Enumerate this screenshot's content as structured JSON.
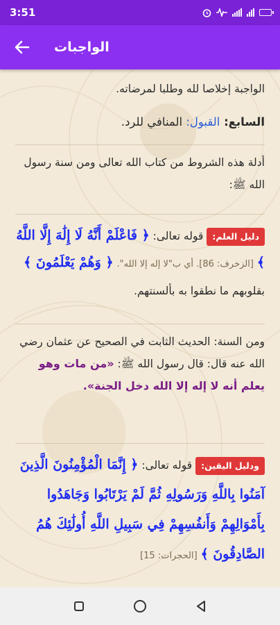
{
  "status_bar": {
    "time": "3:51"
  },
  "app_bar": {
    "title": "الواجبات",
    "back_icon": "arrow-back-icon"
  },
  "content": {
    "p0": "الواجبة إخلاصا لله وطلبا لمرضاته.",
    "p1_label": "السابع: ",
    "p1_term": "القبول: ",
    "p1_text": "المنافي للرد.",
    "p2": "أدلة هذه الشروط من كتاب الله تعالى ومن سنة رسول الله ﷺ:",
    "b1_badge": "دليل العلم:",
    "b1_intro": "قوله تعالى: ",
    "b1_verse1": "﴿ فَاعْلَمْ أَنَّهُ لَا إِلَٰهَ إِلَّا اللَّهُ ﴾",
    "b1_ref": "[الزخرف: 86]. أي ب\"لا إله إلا الله\".",
    "b1_verse2": "﴿ وَهُمْ يَعْلَمُونَ ﴾",
    "b1_tail": "بقلوبهم ما نطقوا به بألسنتهم.",
    "p3_text": "ومن السنة: الحديث الثابت في الصحيح عن عثمان رضي الله عنه قال: قال رسول الله ﷺ: ",
    "p3_hadith": "«من مات وهو يعلم أنه لا إله إلا الله دخل الجنة».",
    "b2_badge": "ودليل اليقين:",
    "b2_intro": "قوله تعالى: ",
    "b2_verse": "﴿ إِنَّمَا الْمُؤْمِنُونَ الَّذِينَ آمَنُوا بِاللَّهِ وَرَسُولِهِ ثُمَّ لَمْ يَرْتَابُوا وَجَاهَدُوا بِأَمْوَالِهِمْ وَأَنفُسِهِمْ فِي سَبِيلِ اللَّهِ أُولَٰئِكَ هُمُ الصَّادِقُونَ ﴾",
    "b2_ref": "[الحجرات: 15]"
  },
  "colors": {
    "status_bar": "#7a22d6",
    "app_bar": "#8b2ff0",
    "background": "#f3ead9",
    "badge": "#e03838",
    "quran": "#1e2cf0",
    "hadith": "#7a1e86"
  },
  "nav_bar": {
    "icons": [
      "recents-square-icon",
      "home-circle-icon",
      "back-triangle-icon"
    ]
  }
}
